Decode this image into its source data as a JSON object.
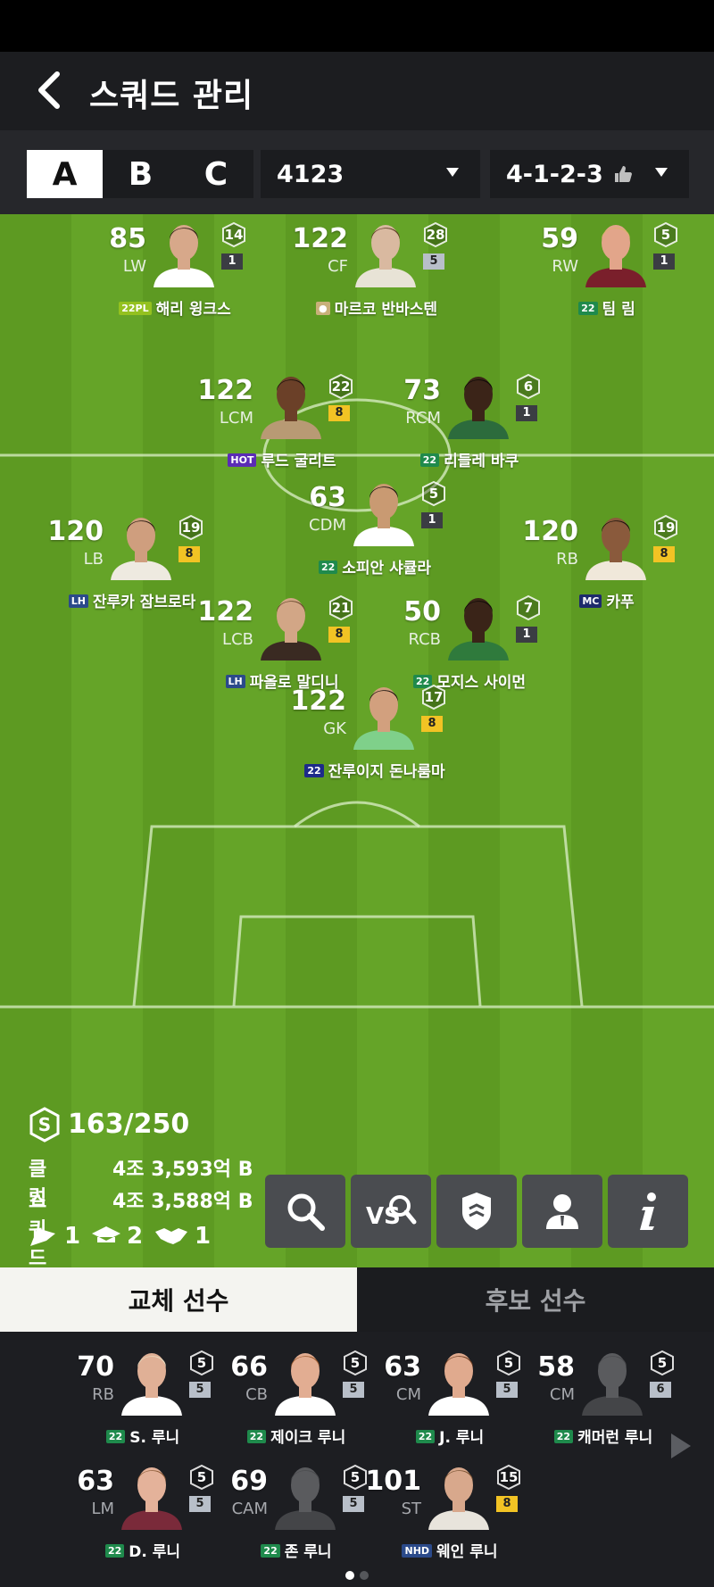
{
  "header": {
    "title": "스쿼드 관리"
  },
  "tabs_squad": [
    "A",
    "B",
    "C"
  ],
  "formation_dropdown": "4123",
  "tactic_dropdown": "4-1-2-3",
  "starters": [
    {
      "rating": "85",
      "pos": "LW",
      "level": "14",
      "enh": "1",
      "enh_color": "dark",
      "season": "22PL",
      "season_color": "#94c11f",
      "name": "해리 윙크스",
      "skin": "#d7a88a",
      "shirt": "#ffffff",
      "hair": "#2a1d14"
    },
    {
      "rating": "122",
      "pos": "CF",
      "level": "28",
      "enh": "5",
      "enh_color": "silver",
      "season": "●",
      "season_color": "#c8b07a",
      "name": "마르코 반바스텐",
      "skin": "#d9b9a0",
      "shirt": "#e8e3d6",
      "hair": "#5a3b22"
    },
    {
      "rating": "59",
      "pos": "RW",
      "level": "5",
      "enh": "1",
      "enh_color": "dark",
      "season": "22",
      "season_color": "#1f8a4c",
      "name": "팀 림",
      "skin": "#e2a58a",
      "shirt": "#7a1f2b",
      "hair": "#d9b36a"
    },
    {
      "rating": "122",
      "pos": "LCM",
      "level": "22",
      "enh": "8",
      "enh_color": "gold",
      "season": "HOT",
      "season_color": "#5b2bb5",
      "name": "루드 굴리트",
      "skin": "#6b4028",
      "shirt": "#b89a74",
      "hair": "#1c120c"
    },
    {
      "rating": "73",
      "pos": "RCM",
      "level": "6",
      "enh": "1",
      "enh_color": "dark",
      "season": "22",
      "season_color": "#1f8a4c",
      "name": "리들레 바쿠",
      "skin": "#3b2418",
      "shirt": "#2c6b3c",
      "hair": "#0e0907"
    },
    {
      "rating": "63",
      "pos": "CDM",
      "level": "5",
      "enh": "1",
      "enh_color": "dark",
      "season": "22",
      "season_color": "#1f8a4c",
      "name": "소피안 샤큘라",
      "skin": "#c99a72",
      "shirt": "#ffffff",
      "hair": "#1a1410"
    },
    {
      "rating": "120",
      "pos": "LB",
      "level": "19",
      "enh": "8",
      "enh_color": "gold",
      "season": "LH",
      "season_color": "#2b4a8a",
      "name": "잔루카 잠브로타",
      "skin": "#cf9e7e",
      "shirt": "#eeeae0",
      "hair": "#2b1c12"
    },
    {
      "rating": "120",
      "pos": "RB",
      "level": "19",
      "enh": "8",
      "enh_color": "gold",
      "season": "MC",
      "season_color": "#1d2a6b",
      "name": "카푸",
      "skin": "#8a5a3c",
      "shirt": "#f0e8da",
      "hair": "#1a120c"
    },
    {
      "rating": "122",
      "pos": "LCB",
      "level": "21",
      "enh": "8",
      "enh_color": "gold",
      "season": "LH",
      "season_color": "#2b4a8a",
      "name": "파올로 말디니",
      "skin": "#d2a686",
      "shirt": "#3a2a22",
      "hair": "#6a4a2e"
    },
    {
      "rating": "50",
      "pos": "RCB",
      "level": "7",
      "enh": "1",
      "enh_color": "dark",
      "season": "22",
      "season_color": "#1f8a4c",
      "name": "모지스 사이먼",
      "skin": "#3a2418",
      "shirt": "#2f7a3c",
      "hair": "#0f0a08"
    },
    {
      "rating": "122",
      "pos": "GK",
      "level": "17",
      "enh": "8",
      "enh_color": "gold",
      "season": "22",
      "season_color": "#1d2a8a",
      "name": "잔루이지 돈나룸마",
      "skin": "#d2a07e",
      "shirt": "#7fd08a",
      "hair": "#1d150f"
    }
  ],
  "squad": {
    "score": "163/250",
    "club_label": "클럽",
    "club_value": "4조 3,593억 B",
    "squad_label": "스쿼드",
    "squad_value": "4조 3,588억 B",
    "stat_flag": "1",
    "stat_cap": "2",
    "stat_hand": "1"
  },
  "toolbar_icons": [
    "search-icon",
    "vs-search-icon",
    "shield-icon",
    "person-icon",
    "info-icon"
  ],
  "bottom_tabs": [
    "교체 선수",
    "후보 선수"
  ],
  "bench": [
    {
      "rating": "70",
      "pos": "RB",
      "level": "5",
      "enh": "5",
      "enh_color": "silver",
      "season": "22",
      "season_color": "#1f8a4c",
      "name": "S. 루니",
      "skin": "#e0b096",
      "shirt": "#ffffff",
      "hair": "#e8dcc0"
    },
    {
      "rating": "66",
      "pos": "CB",
      "level": "5",
      "enh": "5",
      "enh_color": "silver",
      "season": "22",
      "season_color": "#1f8a4c",
      "name": "제이크 루니",
      "skin": "#e2ad92",
      "shirt": "#ffffff",
      "hair": "#9a5a2e"
    },
    {
      "rating": "63",
      "pos": "CM",
      "level": "5",
      "enh": "5",
      "enh_color": "silver",
      "season": "22",
      "season_color": "#1f8a4c",
      "name": "J. 루니",
      "skin": "#e0aa8e",
      "shirt": "#ffffff",
      "hair": "#6a3a1e"
    },
    {
      "rating": "58",
      "pos": "CM",
      "level": "5",
      "enh": "6",
      "enh_color": "silver",
      "season": "22",
      "season_color": "#1f8a4c",
      "name": "캐머런 루니",
      "skin": "#5a5b5e",
      "shirt": "#444548",
      "hair": "#4a4b4e"
    },
    {
      "rating": "63",
      "pos": "LM",
      "level": "5",
      "enh": "5",
      "enh_color": "silver",
      "season": "22",
      "season_color": "#1f8a4c",
      "name": "D. 루니",
      "skin": "#e4b29a",
      "shirt": "#7a2a3a",
      "hair": "#8a5a36"
    },
    {
      "rating": "69",
      "pos": "CAM",
      "level": "5",
      "enh": "5",
      "enh_color": "silver",
      "season": "22",
      "season_color": "#1f8a4c",
      "name": "존 루니",
      "skin": "#5a5b5e",
      "shirt": "#444548",
      "hair": "#4a4b4e"
    },
    {
      "rating": "101",
      "pos": "ST",
      "level": "15",
      "enh": "8",
      "enh_color": "gold",
      "season": "NHD",
      "season_color": "#2b4a8a",
      "name": "웨인 루니",
      "skin": "#d8a88c",
      "shirt": "#e8e4dc",
      "hair": "#7a5434"
    }
  ]
}
